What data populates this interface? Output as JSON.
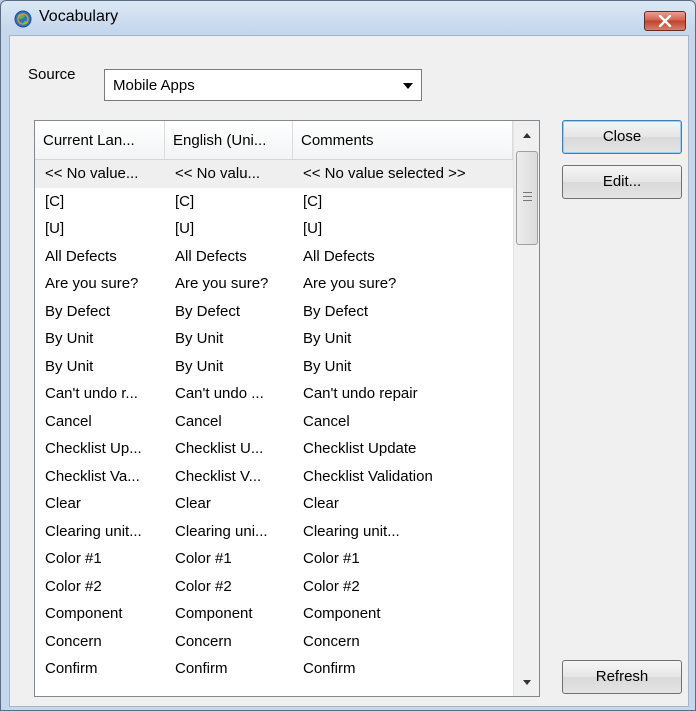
{
  "window": {
    "title": "Vocabulary"
  },
  "source": {
    "label": "Source",
    "value": "Mobile Apps"
  },
  "table": {
    "columns": [
      "Current Lan...",
      "English (Uni...",
      "Comments"
    ],
    "rows": [
      [
        "<< No value...",
        "<< No valu...",
        "<< No value selected >>"
      ],
      [
        "[C]",
        "[C]",
        "[C]"
      ],
      [
        "[U]",
        "[U]",
        "[U]"
      ],
      [
        "All Defects",
        "All Defects",
        "All Defects"
      ],
      [
        "Are you sure?",
        "Are you sure?",
        "Are you sure?"
      ],
      [
        "By Defect",
        "By Defect",
        "By Defect"
      ],
      [
        "By Unit",
        "By Unit",
        "By Unit"
      ],
      [
        "By Unit",
        "By Unit",
        "By Unit"
      ],
      [
        "Can't undo r...",
        "Can't undo ...",
        "Can't undo repair"
      ],
      [
        "Cancel",
        "Cancel",
        "Cancel"
      ],
      [
        "Checklist Up...",
        "Checklist U...",
        "Checklist Update"
      ],
      [
        "Checklist Va...",
        "Checklist V...",
        "Checklist Validation"
      ],
      [
        "Clear",
        "Clear",
        "Clear"
      ],
      [
        "Clearing unit...",
        "Clearing uni...",
        "Clearing unit..."
      ],
      [
        "Color #1",
        "Color #1",
        "Color #1"
      ],
      [
        "Color #2",
        "Color #2",
        "Color #2"
      ],
      [
        "Component",
        "Component",
        "Component"
      ],
      [
        "Concern",
        "Concern",
        "Concern"
      ],
      [
        "Confirm",
        "Confirm",
        "Confirm"
      ]
    ]
  },
  "buttons": {
    "close": "Close",
    "edit": "Edit...",
    "refresh": "Refresh"
  }
}
